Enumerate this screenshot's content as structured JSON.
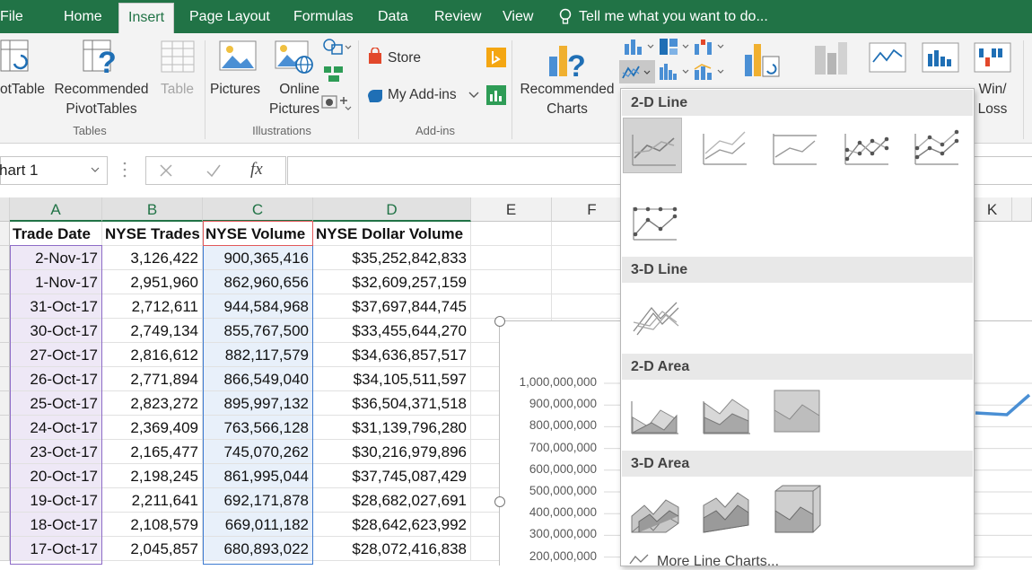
{
  "tabs": [
    "File",
    "Home",
    "Insert",
    "Page Layout",
    "Formulas",
    "Data",
    "Review",
    "View"
  ],
  "tell_me": "Tell me what you want to do...",
  "ribbon": {
    "pivottable": "otTable",
    "recommended_pivottables": [
      "Recommended",
      "PivotTables"
    ],
    "table": "Table",
    "tables_group": "Tables",
    "pictures": "Pictures",
    "online_pictures": [
      "Online",
      "Pictures"
    ],
    "illustrations_group": "Illustrations",
    "store": "Store",
    "my_addins": "My Add-ins",
    "addins_group": "Add-ins",
    "recommended_charts": [
      "Recommended",
      "Charts"
    ],
    "winloss": [
      "Win/",
      "Loss"
    ]
  },
  "name_box": "hart 1",
  "fx": "fx",
  "columns": [
    "A",
    "B",
    "C",
    "D",
    "E",
    "F",
    "K"
  ],
  "headers": [
    "Trade Date",
    "NYSE Trades",
    "NYSE Volume",
    "NYSE Dollar Volume"
  ],
  "rows": [
    [
      "2-Nov-17",
      "3,126,422",
      "900,365,416",
      "$35,252,842,833"
    ],
    [
      "1-Nov-17",
      "2,951,960",
      "862,960,656",
      "$32,609,257,159"
    ],
    [
      "31-Oct-17",
      "2,712,611",
      "944,584,968",
      "$37,697,844,745"
    ],
    [
      "30-Oct-17",
      "2,749,134",
      "855,767,500",
      "$33,455,644,270"
    ],
    [
      "27-Oct-17",
      "2,816,612",
      "882,117,579",
      "$34,636,857,517"
    ],
    [
      "26-Oct-17",
      "2,771,894",
      "866,549,040",
      "$34,105,511,597"
    ],
    [
      "25-Oct-17",
      "2,823,272",
      "895,997,132",
      "$36,504,371,518"
    ],
    [
      "24-Oct-17",
      "2,369,409",
      "763,566,128",
      "$31,139,796,280"
    ],
    [
      "23-Oct-17",
      "2,165,477",
      "745,070,262",
      "$30,216,979,896"
    ],
    [
      "20-Oct-17",
      "2,198,245",
      "861,995,044",
      "$37,745,087,429"
    ],
    [
      "19-Oct-17",
      "2,211,641",
      "692,171,878",
      "$28,682,027,691"
    ],
    [
      "18-Oct-17",
      "2,108,579",
      "669,011,182",
      "$28,642,623,992"
    ],
    [
      "17-Oct-17",
      "2,045,857",
      "680,893,022",
      "$28,072,416,838"
    ]
  ],
  "chart_yticks": [
    "1,000,000,000",
    "900,000,000",
    "800,000,000",
    "700,000,000",
    "600,000,000",
    "500,000,000",
    "400,000,000",
    "300,000,000",
    "200,000,000"
  ],
  "dropdown": {
    "sections": [
      "2-D Line",
      "3-D Line",
      "2-D Area",
      "3-D Area"
    ],
    "more": "More Line Charts..."
  },
  "colors": {
    "excel_green": "#217346",
    "series_blue": "#4a8fd4"
  }
}
